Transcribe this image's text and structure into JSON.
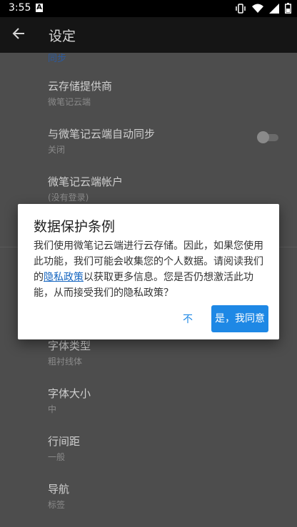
{
  "status_bar": {
    "time": "3:55",
    "notification_glyph": "A"
  },
  "toolbar": {
    "title": "设定"
  },
  "settings": {
    "section_header": "同步",
    "items": [
      {
        "title": "云存储提供商",
        "summary": "微笔记云端"
      },
      {
        "title": "与微笔记云端自动同步",
        "summary": "关闭",
        "toggle_on": false
      },
      {
        "title": "微笔记云端帐户",
        "summary": "(没有登录)"
      },
      {
        "title": "字体类型",
        "summary": "粗衬线体"
      },
      {
        "title": "字体大小",
        "summary": "中"
      },
      {
        "title": "行间距",
        "summary": "一般"
      },
      {
        "title": "导航",
        "summary": "标签"
      }
    ]
  },
  "dialog": {
    "title": "数据保护条例",
    "body_before_link": "我们使用微笔记云端进行云存储。因此，如果您使用此功能，我们可能会收集您的个人数据。请阅读我们的",
    "link_text": "隐私政策",
    "body_after_link": "以获取更多信息。您是否仍想激活此功能，从而接受我们的隐私政策？",
    "negative_button": "不",
    "positive_button": "是，我同意"
  },
  "colors": {
    "accent": "#1e88e5",
    "link": "#1565c0",
    "scrim_background": "#4d4d4d",
    "toolbar": "#151515"
  },
  "icons": [
    "back-arrow-icon",
    "vibrate-icon",
    "wifi-icon",
    "signal-icon",
    "battery-icon",
    "notification-a-icon"
  ]
}
